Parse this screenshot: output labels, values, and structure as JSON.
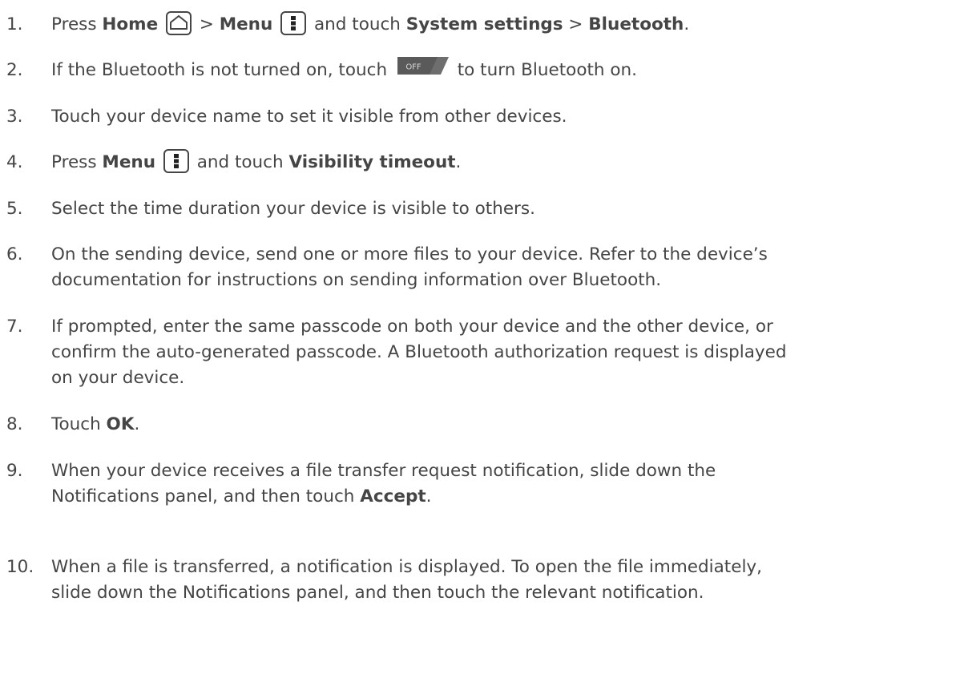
{
  "steps": [
    {
      "num": "1.",
      "lines": [
        [
          {
            "t": "Press "
          },
          {
            "t": "Home",
            "b": true
          },
          {
            "t": " "
          },
          {
            "icon": "home-icon"
          },
          {
            "t": " > "
          },
          {
            "t": "Menu",
            "b": true
          },
          {
            "t": " "
          },
          {
            "icon": "menu-icon"
          },
          {
            "t": " and touch "
          },
          {
            "t": "System settings",
            "b": true
          },
          {
            "t": " > "
          },
          {
            "t": "Bluetooth",
            "b": true
          },
          {
            "t": "."
          }
        ]
      ]
    },
    {
      "num": "2.",
      "lines": [
        [
          {
            "t": "If the Bluetooth is not turned on, touch "
          },
          {
            "toggle": "OFF"
          },
          {
            "t": " to turn Bluetooth on."
          }
        ]
      ]
    },
    {
      "num": "3.",
      "lines": [
        [
          {
            "t": "Touch your device name to set it visible from other devices."
          }
        ]
      ]
    },
    {
      "num": "4.",
      "lines": [
        [
          {
            "t": "Press "
          },
          {
            "t": "Menu",
            "b": true
          },
          {
            "t": " "
          },
          {
            "icon": "menu-icon"
          },
          {
            "t": " and touch "
          },
          {
            "t": "Visibility timeout",
            "b": true
          },
          {
            "t": "."
          }
        ]
      ]
    },
    {
      "num": "5.",
      "lines": [
        [
          {
            "t": "Select the time duration your device is visible to others."
          }
        ]
      ]
    },
    {
      "num": "6.",
      "lines": [
        [
          {
            "t": "On the sending device, send one or more files to your device. Refer to the device’s"
          }
        ],
        [
          {
            "t": "documentation for instructions on sending information over Bluetooth."
          }
        ]
      ]
    },
    {
      "num": "7.",
      "lines": [
        [
          {
            "t": "If prompted, enter the same passcode on both your device and the other device, or"
          }
        ],
        [
          {
            "t": "confirm the auto-generated passcode. A Bluetooth authorization request is displayed"
          }
        ],
        [
          {
            "t": "on your device."
          }
        ]
      ]
    },
    {
      "num": "8.",
      "lines": [
        [
          {
            "t": "Touch "
          },
          {
            "t": "OK",
            "b": true
          },
          {
            "t": "."
          }
        ]
      ]
    },
    {
      "num": "9.",
      "lines": [
        [
          {
            "t": "When your device receives a file transfer request notification, slide down the"
          }
        ],
        [
          {
            "t": "Notifications panel, and then touch "
          },
          {
            "t": "Accept",
            "b": true
          },
          {
            "t": "."
          }
        ]
      ]
    },
    {
      "num": "10.",
      "lines": [
        [
          {
            "t": "When a file is transferred, a notification is displayed. To open the file immediately,"
          }
        ],
        [
          {
            "t": "slide down the Notifications panel, and then touch the relevant notification."
          }
        ]
      ]
    }
  ]
}
